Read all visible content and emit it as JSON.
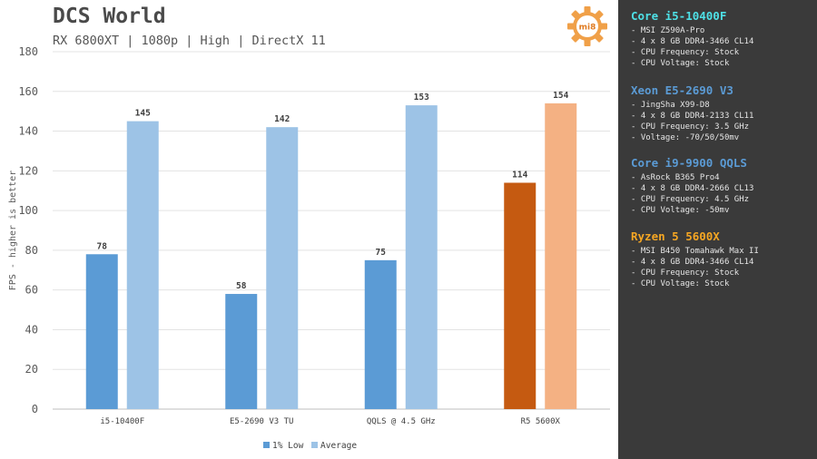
{
  "colors": {
    "intel_low": "#5b9bd5",
    "intel_avg": "#9dc3e6",
    "amd_low": "#c55a11",
    "amd_avg": "#f4b183",
    "cyan": "#4ee0e6",
    "blue": "#5b9bd5",
    "orange": "#f5a623",
    "panel_bg": "#3a3a3a"
  },
  "chart_data": {
    "type": "bar",
    "title": "DCS World",
    "subtitle": "RX 6800XT | 1080p | High | DirectX 11",
    "ylabel": "FPS - higher is better",
    "xlabel": "",
    "ylim": [
      0,
      180
    ],
    "yticks": [
      0,
      20,
      40,
      60,
      80,
      100,
      120,
      140,
      160,
      180
    ],
    "grid": true,
    "legend_position": "bottom-center",
    "categories": [
      "i5-10400F",
      "E5-2690 V3 TU",
      "QQLS @ 4.5 GHz",
      "R5 5600X"
    ],
    "series": [
      {
        "name": "1% Low",
        "values": [
          78,
          58,
          75,
          114
        ]
      },
      {
        "name": "Average",
        "values": [
          145,
          142,
          153,
          154
        ]
      }
    ]
  },
  "logo_text": "mi8",
  "cpus": [
    {
      "name": "Core i5-10400F",
      "color": "cyan",
      "lines": [
        "- MSI Z590A-Pro",
        "- 4 x 8 GB DDR4-3466 CL14",
        "- CPU Frequency: Stock",
        "- CPU Voltage: Stock"
      ]
    },
    {
      "name": "Xeon E5-2690 V3",
      "color": "blue",
      "lines": [
        "- JingSha X99-D8",
        "- 4 x 8 GB DDR4-2133 CL11",
        "- CPU Frequency: 3.5 GHz",
        "- Voltage: -70/50/50mv"
      ]
    },
    {
      "name": "Core i9-9900 QQLS",
      "color": "blue",
      "lines": [
        "- AsRock B365 Pro4",
        "- 4 x 8 GB DDR4-2666 CL13",
        "- CPU Frequency: 4.5 GHz",
        "- CPU Voltage: -50mv"
      ]
    },
    {
      "name": "Ryzen 5 5600X",
      "color": "orange",
      "lines": [
        "- MSI B450 Tomahawk Max II",
        "- 4 x 8 GB DDR4-3466 CL14",
        "- CPU Frequency: Stock",
        "- CPU Voltage: Stock"
      ]
    }
  ]
}
